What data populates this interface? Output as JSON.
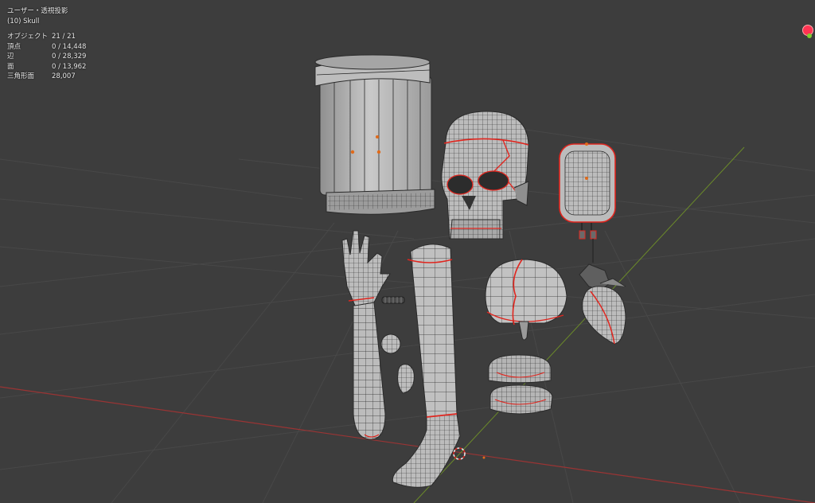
{
  "viewport": {
    "view_label": "ユーザー・透視投影",
    "object_label": "(10) Skull",
    "stats": [
      {
        "label": "オブジェクト",
        "value": "21 / 21"
      },
      {
        "label": "頂点",
        "value": "0 / 14,448"
      },
      {
        "label": "辺",
        "value": "0 / 28,329"
      },
      {
        "label": "面",
        "value": "0 / 13,962"
      },
      {
        "label": "三角形面",
        "value": "28,007"
      }
    ]
  },
  "colors": {
    "background": "#3d3d3d",
    "grid": "#4a4a4a",
    "x_axis": "#9a3434",
    "y_axis": "#6b8a2a",
    "mesh_fill": "#b9b9b9",
    "mesh_wire": "#2a2a2a",
    "seam": "#e0261f"
  },
  "scene_objects": [
    "jar-object",
    "skull-object",
    "iv-bag-object",
    "arm-object",
    "leg-object",
    "brain-object",
    "heart-object",
    "teeth-object",
    "eyeball-object",
    "ear-object",
    "spine-object"
  ]
}
